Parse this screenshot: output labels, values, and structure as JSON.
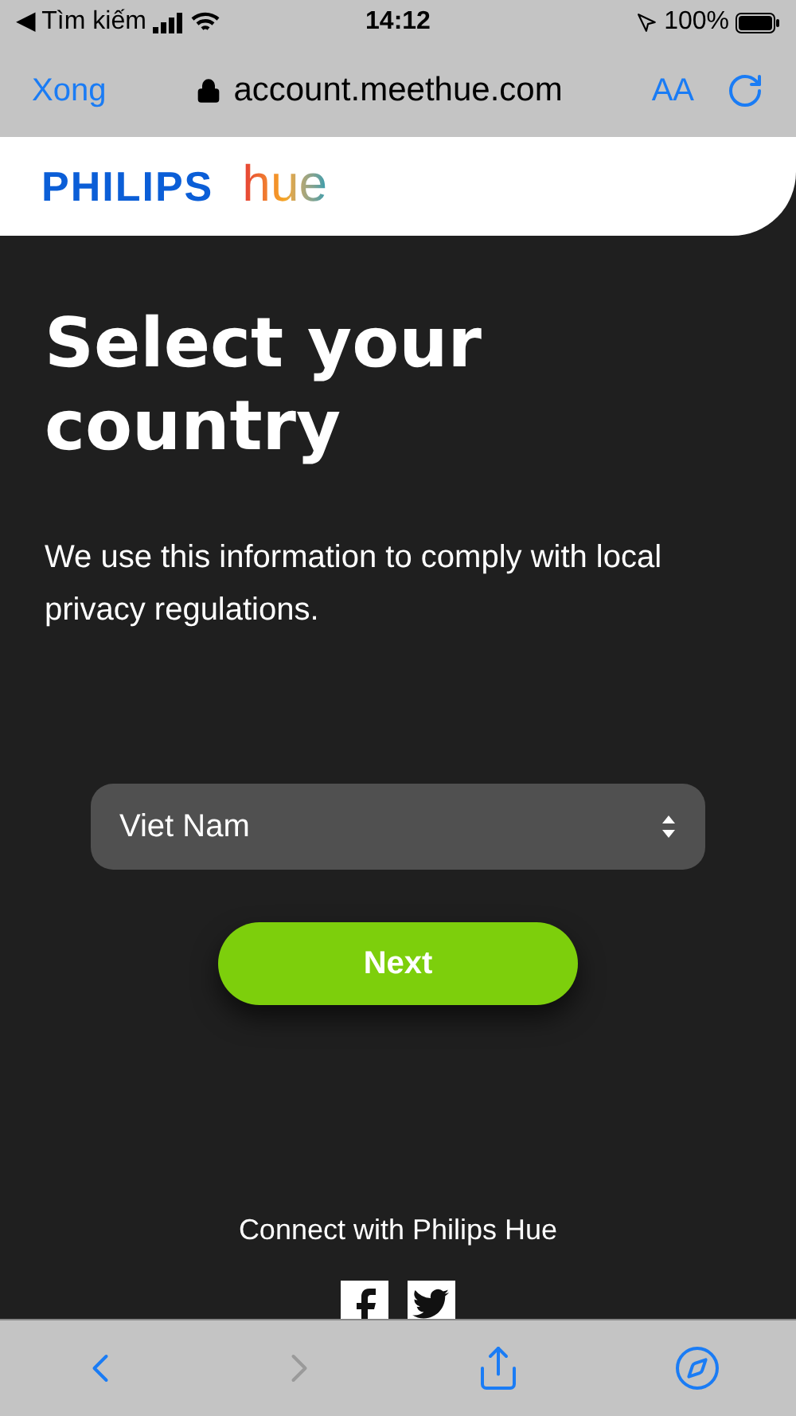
{
  "status_bar": {
    "back_app": "◀ Tìm kiếm",
    "time": "14:12",
    "battery": "100%"
  },
  "address_bar": {
    "done": "Xong",
    "url": "account.meethue.com",
    "text_size": "AA"
  },
  "header": {
    "brand": "PHILIPS",
    "product": "hue"
  },
  "title": "Select your country",
  "description": "We use this information to comply with local privacy regulations.",
  "country_select": {
    "value": "Viet Nam"
  },
  "next_button": "Next",
  "footer": {
    "text": "Connect with Philips Hue"
  },
  "toolbar": [
    {
      "kind": "back",
      "disabled": false
    },
    {
      "kind": "forward",
      "disabled": true
    },
    {
      "kind": "share",
      "disabled": false
    },
    {
      "kind": "compass",
      "disabled": false
    }
  ]
}
